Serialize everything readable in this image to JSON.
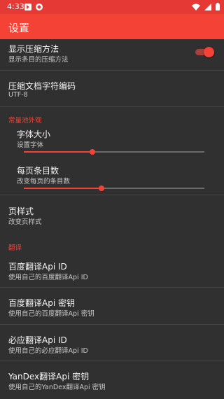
{
  "statusbar": {
    "time": "4:33"
  },
  "appbar": {
    "title": "设置"
  },
  "rows": {
    "show_method": {
      "title": "显示压缩方法",
      "subtitle": "显示条目的压缩方法",
      "toggle_on": true
    },
    "encoding": {
      "title": "压缩文档字符编码",
      "subtitle": "UTF-8"
    },
    "font_size": {
      "title": "字体大小",
      "subtitle": "设置字体",
      "level": 0.38
    },
    "items_per_page": {
      "title": "每页条目数",
      "subtitle": "改变每页的条目数",
      "level": 0.43
    },
    "page_style": {
      "title": "页样式",
      "subtitle": "改变页样式"
    },
    "baidu_id": {
      "title": "百度翻译Api ID",
      "subtitle": "使用自己的百度翻译Api ID"
    },
    "baidu_key": {
      "title": "百度翻译Api 密钥",
      "subtitle": "使用自己的百度翻译Api 密钥"
    },
    "bing_id": {
      "title": "必应翻译Api ID",
      "subtitle": "使用自己的必应翻译Api ID"
    },
    "yandex_key": {
      "title": "YanDex翻译Api 密钥",
      "subtitle": "使用自己的YanDex翻译Api 密钥"
    }
  },
  "sections": {
    "appearance": "常量池外观",
    "translate": "翻译"
  },
  "colors": {
    "accent": "#f44336",
    "statusbar": "#e53935",
    "background": "#303030"
  }
}
